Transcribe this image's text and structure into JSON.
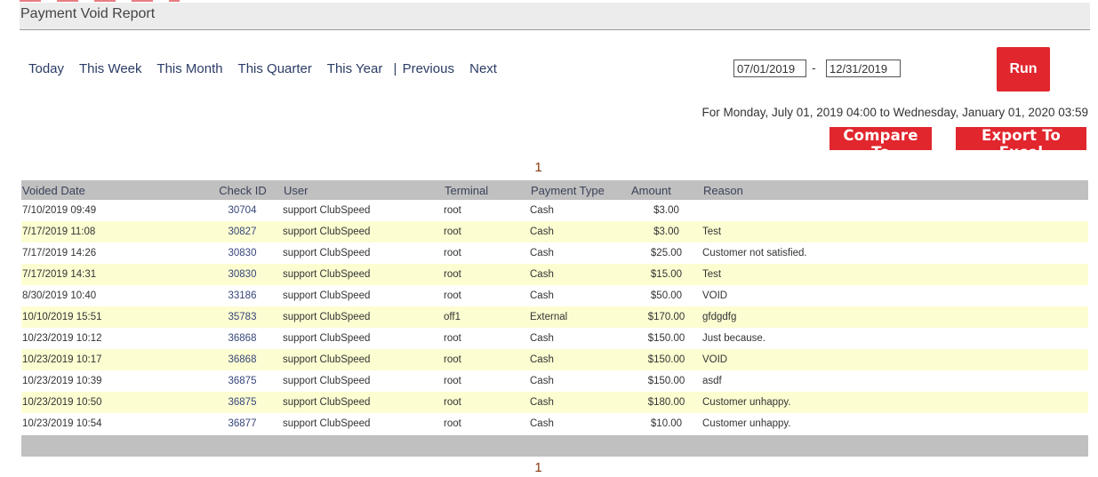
{
  "page": {
    "title": "Payment Void Report"
  },
  "range_nav": {
    "today": "Today",
    "this_week": "This Week",
    "this_month": "This Month",
    "this_quarter": "This Quarter",
    "this_year": "This Year",
    "separator": "|",
    "previous": "Previous",
    "next": "Next"
  },
  "date_range": {
    "start": "07/01/2019",
    "dash": "-",
    "end": "12/31/2019",
    "summary": "For Monday, July 01, 2019 04:00 to Wednesday, January 01, 2020 03:59"
  },
  "buttons": {
    "run": "Run",
    "compare_to": "Compare To",
    "export_to_excel": "Export To Excel"
  },
  "pager": {
    "top_page": "1",
    "bottom_page": "1"
  },
  "table": {
    "headers": {
      "voided_date": "Voided Date",
      "check_id": "Check ID",
      "user": "User",
      "terminal": "Terminal",
      "payment_type": "Payment Type",
      "amount": "Amount",
      "reason": "Reason"
    },
    "rows": [
      {
        "voided_date": "7/10/2019 09:49",
        "check_id": "30704",
        "user": "support ClubSpeed",
        "terminal": "root",
        "payment_type": "Cash",
        "amount": "$3.00",
        "reason": ""
      },
      {
        "voided_date": "7/17/2019 11:08",
        "check_id": "30827",
        "user": "support ClubSpeed",
        "terminal": "root",
        "payment_type": "Cash",
        "amount": "$3.00",
        "reason": "Test"
      },
      {
        "voided_date": "7/17/2019 14:26",
        "check_id": "30830",
        "user": "support ClubSpeed",
        "terminal": "root",
        "payment_type": "Cash",
        "amount": "$25.00",
        "reason": "Customer not satisfied."
      },
      {
        "voided_date": "7/17/2019 14:31",
        "check_id": "30830",
        "user": "support ClubSpeed",
        "terminal": "root",
        "payment_type": "Cash",
        "amount": "$15.00",
        "reason": "Test"
      },
      {
        "voided_date": "8/30/2019 10:40",
        "check_id": "33186",
        "user": "support ClubSpeed",
        "terminal": "root",
        "payment_type": "Cash",
        "amount": "$50.00",
        "reason": "VOID"
      },
      {
        "voided_date": "10/10/2019 15:51",
        "check_id": "35783",
        "user": "support ClubSpeed",
        "terminal": "off1",
        "payment_type": "External",
        "amount": "$170.00",
        "reason": "gfdgdfg"
      },
      {
        "voided_date": "10/23/2019 10:12",
        "check_id": "36868",
        "user": "support ClubSpeed",
        "terminal": "root",
        "payment_type": "Cash",
        "amount": "$150.00",
        "reason": "Just because."
      },
      {
        "voided_date": "10/23/2019 10:17",
        "check_id": "36868",
        "user": "support ClubSpeed",
        "terminal": "root",
        "payment_type": "Cash",
        "amount": "$150.00",
        "reason": "VOID"
      },
      {
        "voided_date": "10/23/2019 10:39",
        "check_id": "36875",
        "user": "support ClubSpeed",
        "terminal": "root",
        "payment_type": "Cash",
        "amount": "$150.00",
        "reason": "asdf"
      },
      {
        "voided_date": "10/23/2019 10:50",
        "check_id": "36875",
        "user": "support ClubSpeed",
        "terminal": "root",
        "payment_type": "Cash",
        "amount": "$180.00",
        "reason": "Customer unhappy."
      },
      {
        "voided_date": "10/23/2019 10:54",
        "check_id": "36877",
        "user": "support ClubSpeed",
        "terminal": "root",
        "payment_type": "Cash",
        "amount": "$10.00",
        "reason": "Customer unhappy."
      }
    ]
  },
  "colors": {
    "accent_red": "#e1262d",
    "header_gray": "#c0c0c0",
    "alt_row": "#fdfdd2",
    "link_blue": "#2b3c66",
    "pager_brown": "#8b3a0e"
  }
}
